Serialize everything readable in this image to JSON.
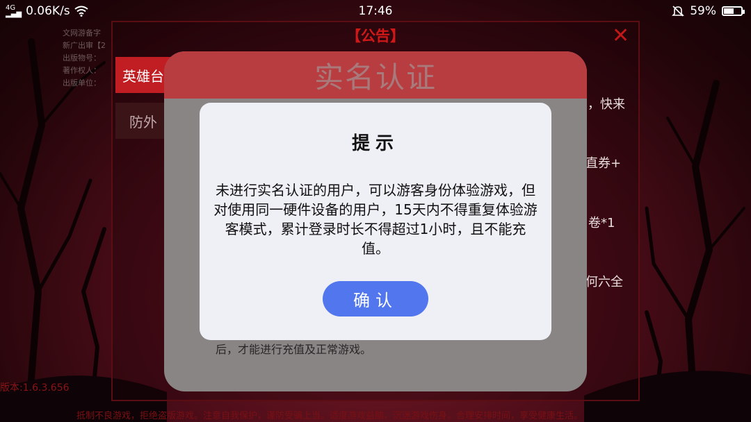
{
  "status_bar": {
    "network_type": "4G",
    "speed": "0.06K/s",
    "time": "17:46",
    "battery_percent": "59%",
    "battery_level": 0.59
  },
  "announcement": {
    "title": "【公告】",
    "tabs": [
      "英雄台",
      "防外"
    ],
    "right_snippets": [
      "，快来",
      "直券+",
      "卷*1",
      "何六全"
    ],
    "info_lines": [
      "文网游备字",
      "新广出审【2",
      "出版物号：",
      "著作权人：",
      "出版单位："
    ],
    "version": "版本:1.6.3.656",
    "bottom_notice": "抵制不良游戏，拒绝盗版游戏。注意自我保护，谨防受骗上当。适度游戏益脑，沉迷游戏伤身。合理安排时间，享受健康生活。"
  },
  "realname": {
    "header": "实名认证",
    "body_tail": "后，才能进行充值及正常游戏。"
  },
  "tip_dialog": {
    "title": "提示",
    "message": "未进行实名认证的用户，可以游客身份体验游戏，但对使用同一硬件设备的用户，15天内不得重复体验游客模式，累计登录时长不得超过1小时，且不能充值。",
    "confirm_label": "确认"
  },
  "colors": {
    "confirm_button": "#5176ee",
    "header_red": "#b83d40",
    "title_red": "#d01818"
  },
  "icons": [
    "signal-icon",
    "wifi-icon",
    "mute-bell-icon",
    "battery-icon",
    "close-x-icon"
  ]
}
